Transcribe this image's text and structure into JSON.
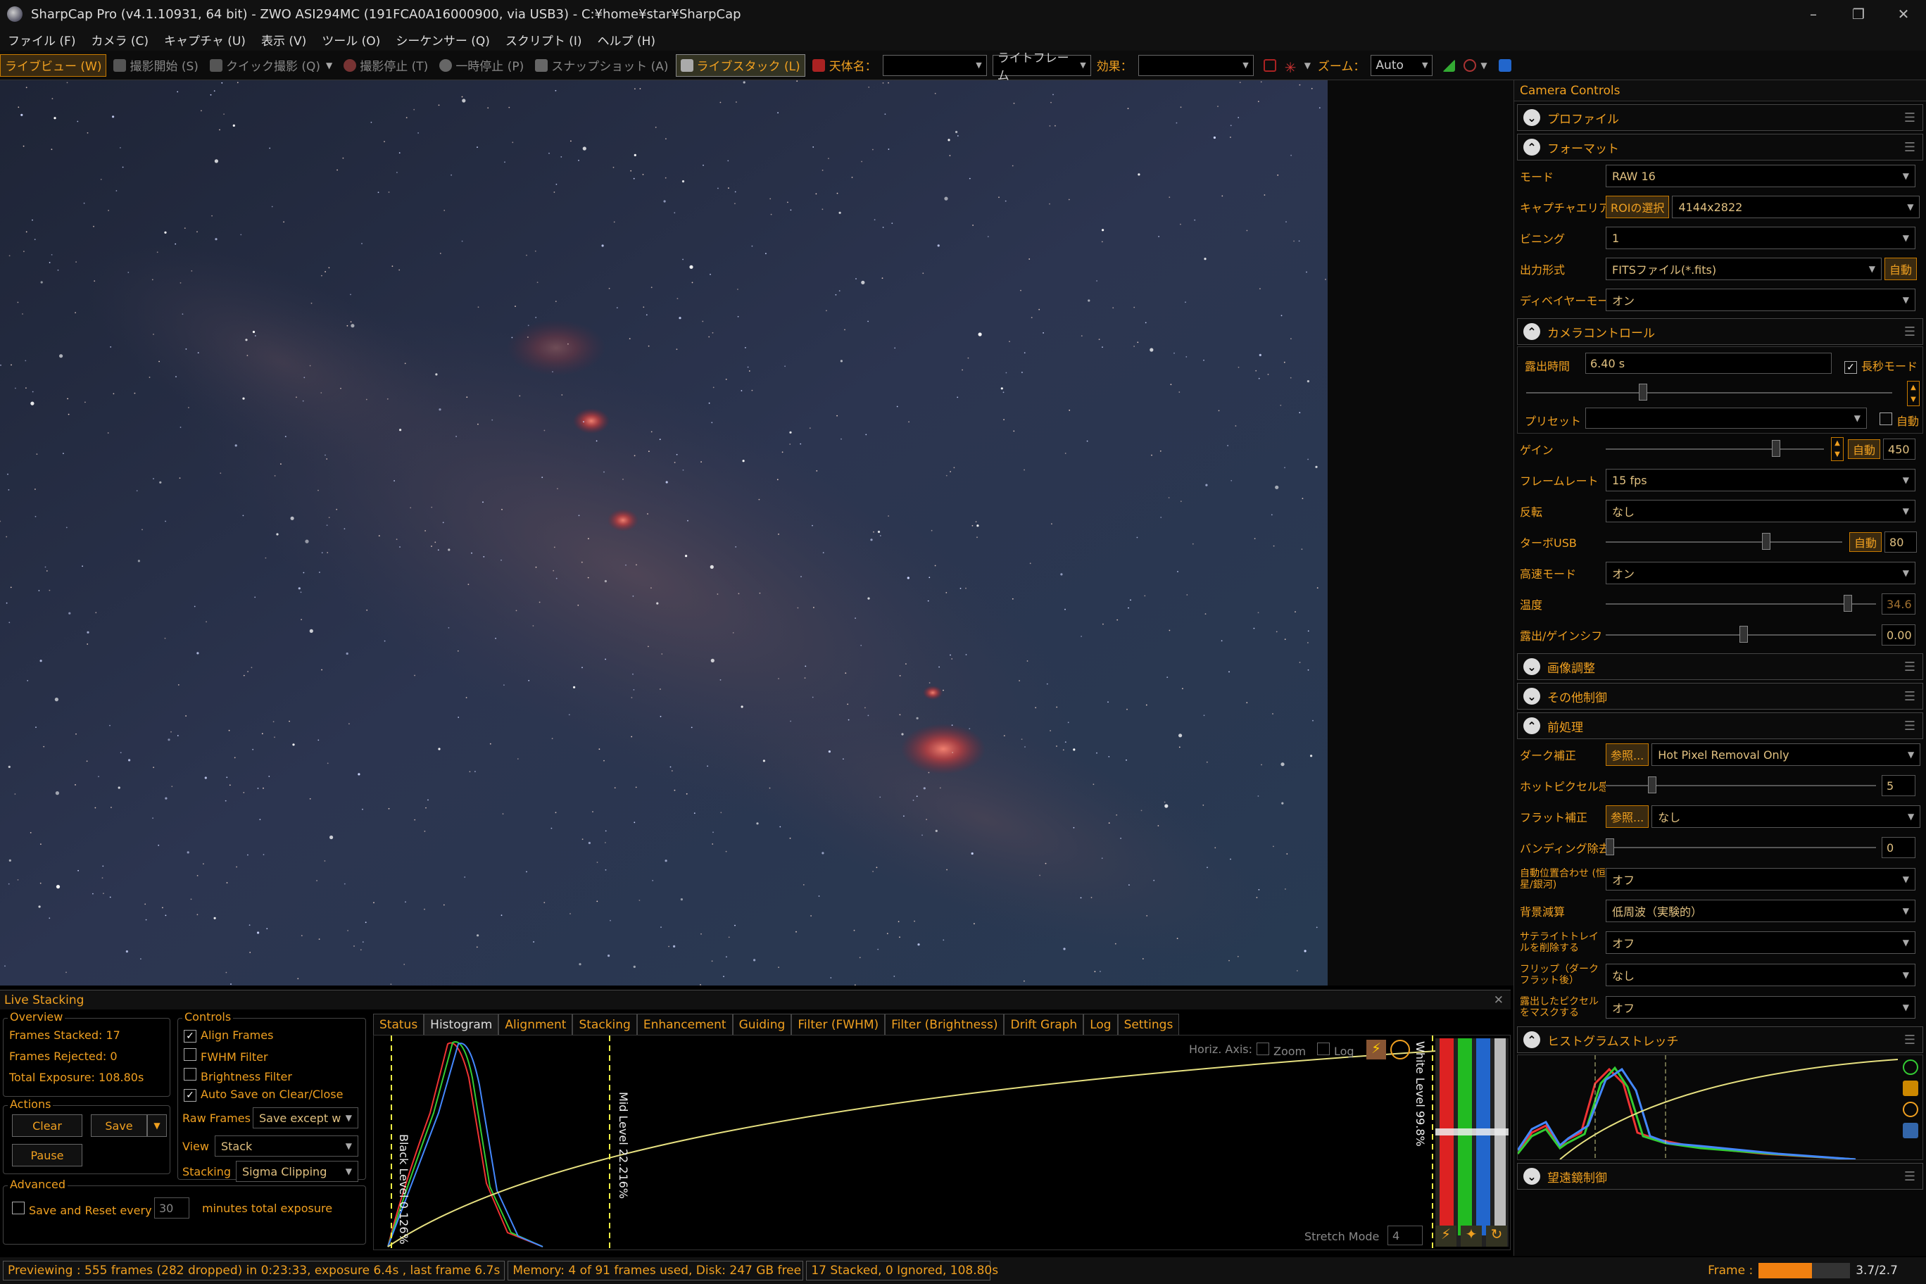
{
  "window": {
    "title": "SharpCap Pro (v4.1.10931, 64 bit) - ZWO ASI294MC (191FCA0A16000900, via USB3) - C:¥home¥star¥SharpCap",
    "minimize": "–",
    "restore": "❐",
    "close": "✕"
  },
  "menu": [
    "ファイル (F)",
    "カメラ (C)",
    "キャプチャ (U)",
    "表示 (V)",
    "ツール (O)",
    "シーケンサー (Q)",
    "スクリプト (I)",
    "ヘルプ (H)"
  ],
  "toolbar": {
    "live_preview": "ライブビュー (W)",
    "start_capture": "撮影開始 (S)",
    "quick_capture": "クイック撮影 (Q)",
    "stop_capture": "撮影停止 (T)",
    "pause": "一時停止 (P)",
    "snapshot": "スナップショット (A)",
    "live_stack": "ライブスタック (L)",
    "target_label": "天体名：",
    "target_value": "",
    "frame_type": "ライトフレーム",
    "effect_label": "効果：",
    "effect_value": "",
    "zoom_label": "ズーム：",
    "zoom_value": "Auto"
  },
  "camera_controls": {
    "title": "Camera Controls",
    "profile": "プロファイル",
    "format": "フォーマット",
    "mode_label": "モード",
    "mode_value": "RAW 16",
    "capture_area_label": "キャプチャエリア",
    "roi_button": "ROIの選択",
    "capture_area_value": "4144x2822",
    "binning_label": "ビニング",
    "binning_value": "1",
    "output_label": "出力形式",
    "output_value": "FITSファイル(*.fits)",
    "output_auto": "自動",
    "debayer_label": "ディベイヤーモード",
    "debayer_value": "オン",
    "camera_control": "カメラコントロール",
    "exposure_label": "露出時間",
    "exposure_value": "6.40 s",
    "long_exposure": "長秒モード",
    "preset_label": "プリセット",
    "preset_value": "",
    "preset_auto": "自動",
    "gain_label": "ゲイン",
    "gain_auto": "自動",
    "gain_value": "450",
    "framerate_label": "フレームレート",
    "framerate_value": "15 fps",
    "flip_label": "反転",
    "flip_value": "なし",
    "turbo_label": "ターボUSB",
    "turbo_auto": "自動",
    "turbo_value": "80",
    "highspeed_label": "高速モード",
    "highspeed_value": "オン",
    "temp_label": "温度",
    "temp_value": "34.6",
    "expgain_label": "露出/ゲインシフト",
    "expgain_value": "0.00",
    "image_adjust": "画像調整",
    "other_controls": "その他制御",
    "preprocess": "前処理",
    "dark_label": "ダーク補正",
    "browse": "参照...",
    "dark_value": "Hot Pixel Removal Only",
    "hotpixel_label": "ホットピクセル感度",
    "hotpixel_value": "5",
    "flat_label": "フラット補正",
    "flat_value": "なし",
    "banding_label": "バンディング除去",
    "banding_value": "0",
    "autoalign_label": "自動位置合わせ (恒星/銀河)",
    "autoalign_value": "オフ",
    "bgsub_label": "背景減算",
    "bgsub_value": "低周波（実験的）",
    "sattrail_label": "サテライトトレイルを削除する",
    "sattrail_value": "オフ",
    "flipdark_label": "フリップ（ダークフラット後）",
    "flipdark_value": "なし",
    "maskpix_label": "露出したピクセルをマスクする",
    "maskpix_value": "オフ",
    "histo_stretch": "ヒストグラムストレッチ",
    "telescope": "望遠鏡制御"
  },
  "live_stacking": {
    "title": "Live Stacking",
    "overview": "Overview",
    "frames_stacked": "Frames Stacked:  17",
    "frames_rejected": "Frames Rejected:  0",
    "total_exposure": "Total Exposure:    108.80s",
    "actions": "Actions",
    "clear": "Clear",
    "save": "Save",
    "pause": "Pause",
    "controls": "Controls",
    "align_frames": "Align Frames",
    "fwhm_filter": "FWHM Filter",
    "brightness_filter": "Brightness Filter",
    "auto_save": "Auto Save on Clear/Close",
    "raw_frames_label": "Raw Frames",
    "raw_frames_value": "Save except w",
    "view_label": "View",
    "view_value": "Stack",
    "stacking_label": "Stacking",
    "stacking_value": "Sigma Clipping",
    "advanced": "Advanced",
    "save_reset": "Save and Reset every",
    "save_reset_value": "30",
    "minutes_total": "minutes total exposure",
    "tabs": [
      "Status",
      "Histogram",
      "Alignment",
      "Stacking",
      "Enhancement",
      "Guiding",
      "Filter (FWHM)",
      "Filter (Brightness)",
      "Drift Graph",
      "Log",
      "Settings"
    ],
    "active_tab": 1,
    "horiz_axis": "Horiz. Axis:",
    "zoom": "Zoom",
    "log": "Log",
    "black_level": "Black Level  0.126%",
    "mid_level": "Mid Level  22.216%",
    "white_level": "White Level  99.8%",
    "stretch_mode": "Stretch Mode",
    "stretch_value": "4"
  },
  "status": {
    "preview": "Previewing : 555 frames (282 dropped) in 0:23:33, exposure 6.4s , last frame 6.7s",
    "memory": "Memory: 4 of 91 frames used, Disk: 247 GB free",
    "stacked": "17 Stacked, 0 Ignored, 108.80s",
    "frame_label": "Frame :",
    "frame_value": "3.7/2.7",
    "frame_progress": 0.58
  },
  "colors": {
    "accent": "#f0a020",
    "sky_core": "#2a3050",
    "nebula": "#d05030"
  }
}
